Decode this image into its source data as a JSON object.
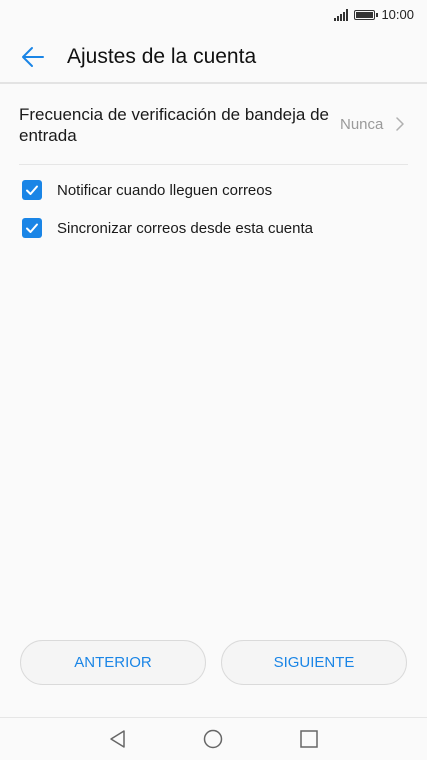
{
  "status_bar": {
    "time": "10:00",
    "icons": [
      "signal-icon",
      "battery-icon"
    ]
  },
  "app_bar": {
    "title": "Ajustes de la cuenta",
    "back_icon": "arrow-left-icon"
  },
  "settings": {
    "frequency": {
      "label": "Frecuencia de verificación de bandeja de entrada",
      "value": "Nunca"
    },
    "checkboxes": [
      {
        "label": "Notificar cuando lleguen correos",
        "checked": true
      },
      {
        "label": "Sincronizar correos desde esta cuenta",
        "checked": true
      }
    ]
  },
  "buttons": {
    "previous": "ANTERIOR",
    "next": "SIGUIENTE"
  },
  "nav_bar": {
    "icons": [
      "nav-back-icon",
      "nav-home-icon",
      "nav-recent-icon"
    ]
  },
  "colors": {
    "accent": "#1a85e6",
    "background": "#fafafa",
    "secondary_text": "#9a9a9a"
  }
}
